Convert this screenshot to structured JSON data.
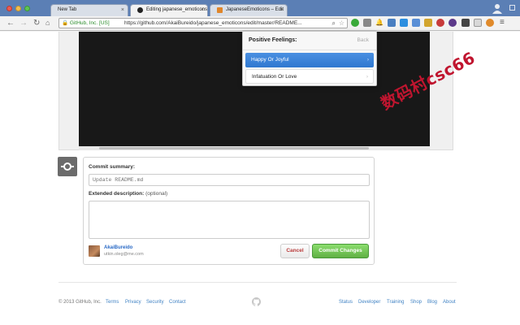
{
  "browser": {
    "tabs": [
      {
        "label": "New Tab",
        "active": false
      },
      {
        "label": "Editing japanese_emoticons",
        "active": true
      },
      {
        "label": "JapaneseEmoticons – Edit",
        "active": false
      }
    ],
    "ev_label": "GitHub, Inc. [US]",
    "url": "https://github.com/AkaiBureido/japanese_emoticons/edit/master/README..."
  },
  "popup": {
    "title": "Positive Feelings:",
    "back_label": "Back",
    "items": [
      {
        "label": "Happy Or Joyful",
        "selected": true
      },
      {
        "label": "Infatuation Or Love",
        "selected": false
      }
    ],
    "chevron": "›"
  },
  "commit": {
    "summary_label": "Commit summary:",
    "summary_placeholder": "Update README.md",
    "description_label": "Extended description:",
    "description_optional": "(optional)",
    "author_name": "AkaiBureido",
    "author_email": "utkin.oleg@me.com",
    "cancel_label": "Cancel",
    "commit_label": "Commit Changes"
  },
  "footer": {
    "copyright": "© 2013 GitHub, Inc.",
    "left_links": [
      "Terms",
      "Privacy",
      "Security",
      "Contact"
    ],
    "right_links": [
      "Status",
      "Developer",
      "Training",
      "Shop",
      "Blog",
      "About"
    ]
  },
  "watermark": "数码村csc66",
  "colors": {
    "accent_blue": "#2f78cf",
    "link_blue": "#4183c4",
    "commit_green": "#60b044",
    "watermark_red": "#c0152f"
  }
}
